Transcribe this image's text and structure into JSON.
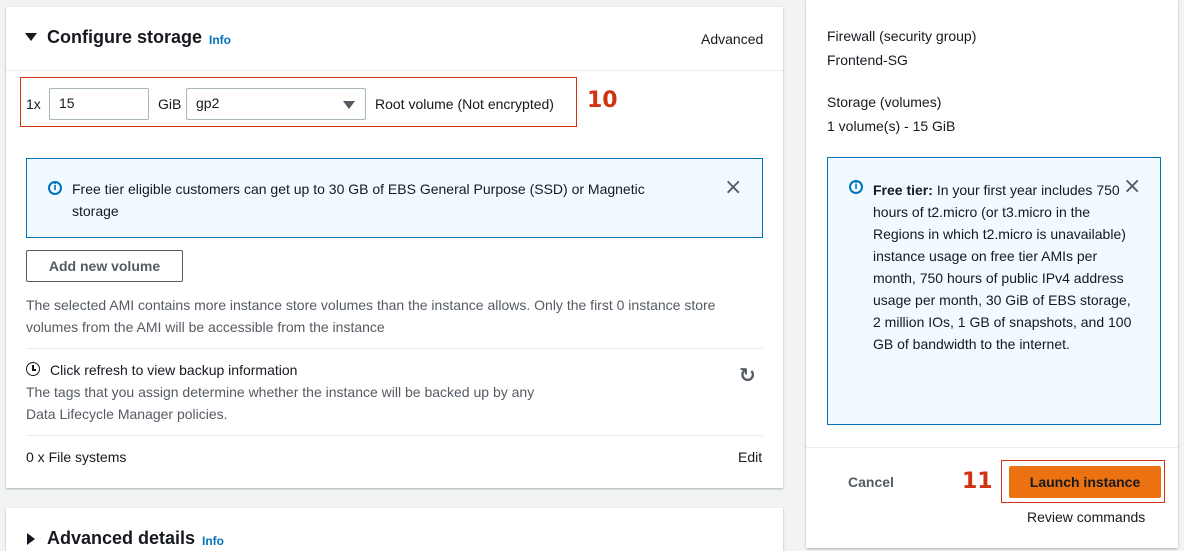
{
  "storage": {
    "title": "Configure storage",
    "info": "Info",
    "advanced": "Advanced",
    "count_prefix": "1x",
    "size_value": "15",
    "size_unit": "GiB",
    "volume_type": "gp2",
    "volume_desc": "Root volume  (Not encrypted)",
    "alert_text": "Free tier eligible customers can get up to 30 GB of EBS General Purpose (SSD) or Magnetic storage",
    "add_volume_label": "Add new volume",
    "ami_note": "The selected AMI contains more instance store volumes than the instance allows. Only the first 0 instance store volumes from the AMI will be accessible from the instance",
    "backup_title": "Click refresh to view backup information",
    "backup_desc_1": "The tags that you assign determine whether the instance will be backed up by any",
    "backup_desc_2": "Data Lifecycle Manager policies.",
    "file_systems": "0 x File systems",
    "edit": "Edit"
  },
  "advanced": {
    "title": "Advanced details",
    "info": "Info"
  },
  "annotations": {
    "n10": "10",
    "n11": "11"
  },
  "summary": {
    "firewall_label": "Firewall (security group)",
    "firewall_value": "Frontend-SG",
    "storage_label": "Storage (volumes)",
    "storage_value": "1 volume(s) - 15 GiB",
    "free_tier_bold": "Free tier:",
    "free_tier_text": "In your first year includes 750 hours of t2.micro (or t3.micro in the Regions in which t2.micro is unavailable) instance usage on free tier AMIs per month, 750 hours of public IPv4 address usage per month, 30 GiB of EBS storage, 2 million IOs, 1 GB of snapshots, and 100 GB of bandwidth to the internet.",
    "cancel": "Cancel",
    "launch": "Launch instance",
    "review": "Review commands"
  },
  "colors": {
    "link": "#0073bb",
    "primary": "#ec7211",
    "annotation": "#d13212"
  }
}
